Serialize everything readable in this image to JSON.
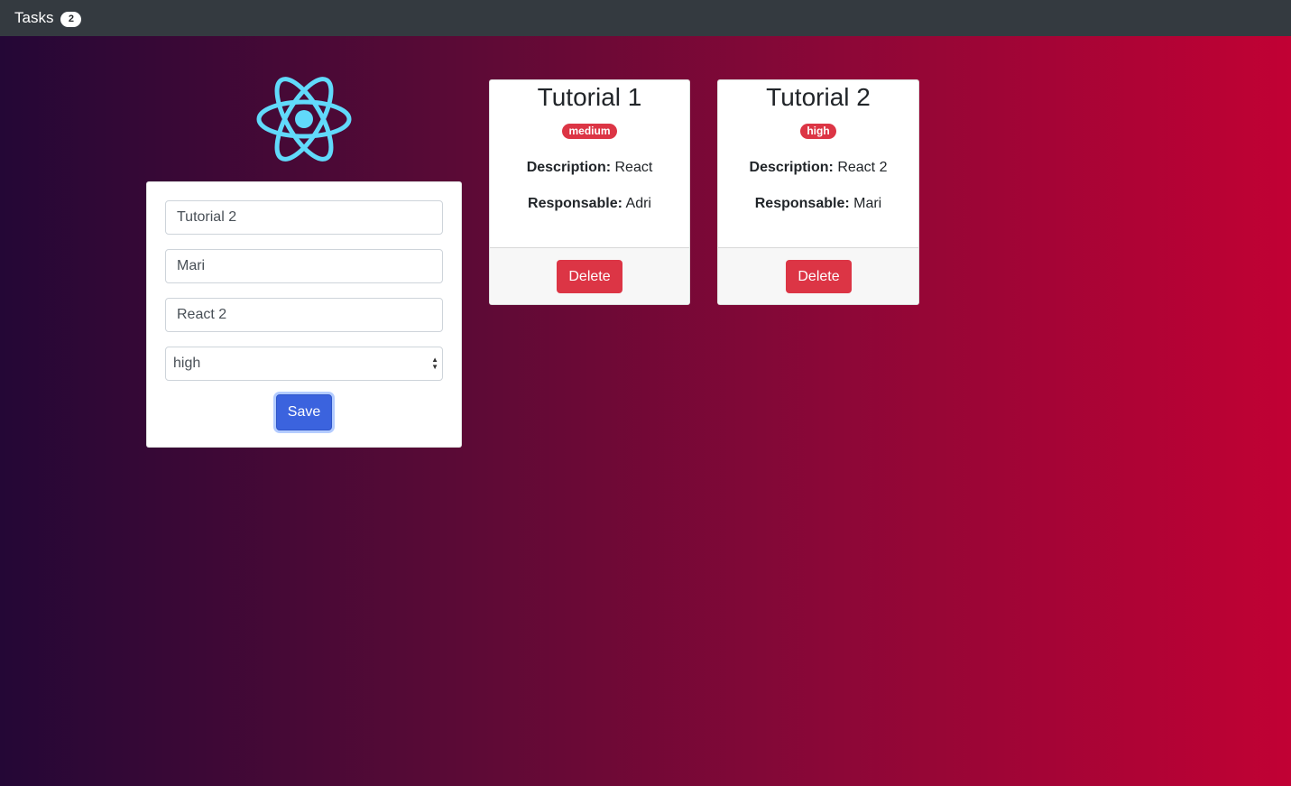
{
  "navbar": {
    "title": "Tasks",
    "count": "2"
  },
  "logo": {
    "icon": "react-atom-icon",
    "color": "#61dafb"
  },
  "form": {
    "title_value": "Tutorial 2",
    "responsible_value": "Mari",
    "description_value": "React 2",
    "priority_selected": "high",
    "save_label": "Save"
  },
  "tasks": [
    {
      "title": "Tutorial 1",
      "priority": "medium",
      "description_label": "Description:",
      "description": "React",
      "responsible_label": "Responsable:",
      "responsible": "Adri",
      "delete_label": "Delete"
    },
    {
      "title": "Tutorial 2",
      "priority": "high",
      "description_label": "Description:",
      "description": "React 2",
      "responsible_label": "Responsable:",
      "responsible": "Mari",
      "delete_label": "Delete"
    }
  ],
  "colors": {
    "navbar": "#343a40",
    "danger": "#dc3545",
    "primary": "#3b63de",
    "gradient_start": "#240736",
    "gradient_end": "#c10134"
  }
}
